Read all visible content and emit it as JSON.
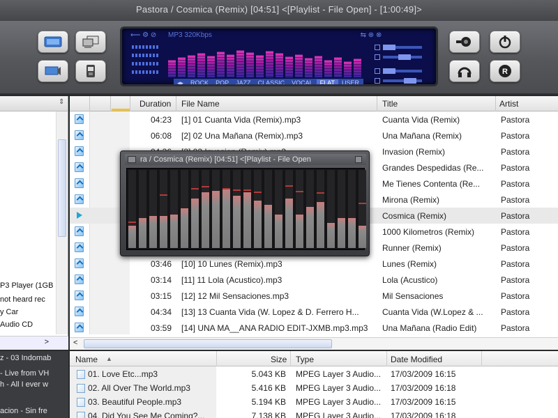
{
  "window": {
    "title": "Pastora / Cosmica (Remix) [04:51]   <[Playlist - File Open] - [1:00:49]>"
  },
  "display": {
    "format": "MP3 320Kbps",
    "presets": [
      "ROCK",
      "POP",
      "JAZZ",
      "CLASSIC",
      "VOCAL",
      "FLAT",
      "USER"
    ],
    "selected_preset": "FLAT",
    "eq_levels": [
      0.55,
      0.62,
      0.7,
      0.75,
      0.68,
      0.8,
      0.72,
      0.85,
      0.78,
      0.7,
      0.82,
      0.76,
      0.65,
      0.72,
      0.6,
      0.68,
      0.55,
      0.62,
      0.5,
      0.58
    ]
  },
  "toolbar": {
    "left_icons": [
      "view-icon",
      "screen-icon",
      "monitor-icon",
      "device-icon"
    ],
    "right_icons": [
      "skin-icon",
      "power-icon",
      "headphones-icon",
      "record-icon"
    ]
  },
  "playlist": {
    "headers": {
      "duration": "Duration",
      "filename": "File Name",
      "title": "Title",
      "artist": "Artist"
    },
    "rows": [
      {
        "duration": "04:23",
        "filename": "[1] 01 Cuanta Vida (Remix).mp3",
        "title": "Cuanta Vida (Remix)",
        "artist": "Pastora",
        "playing": false
      },
      {
        "duration": "06:08",
        "filename": "[2] 02 Una Mañana (Remix).mp3",
        "title": "Una Mañana (Remix)",
        "artist": "Pastora",
        "playing": false
      },
      {
        "duration": "04:36",
        "filename": "[3] 03 Invasion (Remix).mp3",
        "title": "Invasion (Remix)",
        "artist": "Pastora",
        "playing": false
      },
      {
        "duration": "",
        "filename": "",
        "title": "Grandes Despedidas (Re...",
        "artist": "Pastora",
        "playing": false
      },
      {
        "duration": "",
        "filename": "",
        "title": "Me Tienes Contenta (Re...",
        "artist": "Pastora",
        "playing": false
      },
      {
        "duration": "",
        "filename": "",
        "title": "Mirona (Remix)",
        "artist": "Pastora",
        "playing": false
      },
      {
        "duration": "",
        "filename": "",
        "title": "Cosmica (Remix)",
        "artist": "Pastora",
        "playing": true
      },
      {
        "duration": "",
        "filename": "",
        "title": "1000 Kilometros (Remix)",
        "artist": "Pastora",
        "playing": false
      },
      {
        "duration": "",
        "filename": "",
        "title": "Runner (Remix)",
        "artist": "Pastora",
        "playing": false
      },
      {
        "duration": "03:46",
        "filename": "[10] 10 Lunes (Remix).mp3",
        "title": "Lunes (Remix)",
        "artist": "Pastora",
        "playing": false
      },
      {
        "duration": "03:14",
        "filename": "[11] 11 Lola (Acustico).mp3",
        "title": "Lola (Acustico)",
        "artist": "Pastora",
        "playing": false
      },
      {
        "duration": "03:15",
        "filename": "[12] 12 Mil Sensaciones.mp3",
        "title": "Mil Sensaciones",
        "artist": "Pastora",
        "playing": false
      },
      {
        "duration": "04:34",
        "filename": "[13] 13 Cuanta Vida (W. Lopez & D. Ferrero H...",
        "title": "Cuanta Vida (W.Lopez & ...",
        "artist": "Pastora",
        "playing": false
      },
      {
        "duration": "03:59",
        "filename": "[14] UNA MA__ANA RADIO EDIT-JXMB.mp3.mp3",
        "title": "Una Mañana (Radio Edit)",
        "artist": "Pastora",
        "playing": false
      }
    ]
  },
  "mini_player": {
    "title": "ra / Cosmica (Remix) [04:51]   <[Playlist - File Open",
    "levels": [
      0.28,
      0.38,
      0.4,
      0.4,
      0.42,
      0.5,
      0.62,
      0.7,
      0.72,
      0.75,
      0.66,
      0.7,
      0.6,
      0.54,
      0.42,
      0.62,
      0.42,
      0.52,
      0.58,
      0.32,
      0.38,
      0.38,
      0.28
    ],
    "peaks": [
      0.32,
      0,
      0,
      0.66,
      0,
      0,
      0.74,
      0.76,
      0,
      0.74,
      0.72,
      0.72,
      0.69,
      0,
      0,
      0.77,
      0.7,
      0,
      0.68,
      0,
      0,
      0,
      0.55
    ]
  },
  "tree": {
    "items": [
      "P3 Player (1GB",
      "not heard rec",
      "y Car",
      "Audio CD"
    ]
  },
  "left_bottom": {
    "items": [
      "z - 03 Indomab",
      "- Live from VH",
      "h - All I ever w",
      "acion - Sin fre"
    ]
  },
  "files": {
    "headers": {
      "name": "Name",
      "size": "Size",
      "type": "Type",
      "date": "Date Modified"
    },
    "rows": [
      {
        "name": "01. Love Etc...mp3",
        "size": "5.043 KB",
        "type": "MPEG Layer 3 Audio...",
        "date": "17/03/2009 16:15"
      },
      {
        "name": "02. All Over The World.mp3",
        "size": "5.416 KB",
        "type": "MPEG Layer 3 Audio...",
        "date": "17/03/2009 16:18"
      },
      {
        "name": "03. Beautiful People.mp3",
        "size": "5.194 KB",
        "type": "MPEG Layer 3 Audio...",
        "date": "17/03/2009 16:15"
      },
      {
        "name": "04. Did You See Me Coming?...",
        "size": "7.138 KB",
        "type": "MPEG Layer 3 Audio...",
        "date": "17/03/2009 16:18"
      }
    ]
  }
}
